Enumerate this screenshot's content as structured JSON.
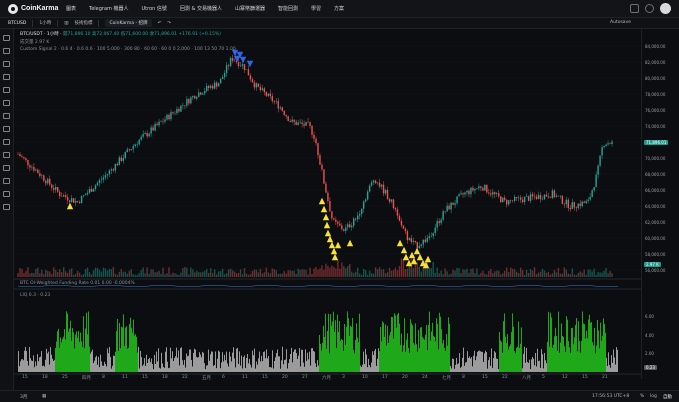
{
  "app": {
    "name": "CoinKarma"
  },
  "nav": {
    "items": [
      "圖表",
      "Telegram 機器人",
      "Utron 信號",
      "回測 & 交易機器人",
      "山寨幣篩選器",
      "智能回測",
      "學習",
      "方案"
    ]
  },
  "toolbar": {
    "symbol": "BTCUSD",
    "interval": "1小時",
    "indicators": "技術指標",
    "layout_tab": "CoinKarma - 招牌",
    "autosave": "Autosave"
  },
  "chart": {
    "title": "BTC/USDT · 1小時 · ",
    "ohlc": "開71,896.10 高72,067.40 低71,600.00 收71,896.01 +176.91 (+0.15%)",
    "volume": "成交量  2.97 K",
    "custom_signal": "Custom Signal  2 · 0.6 4 · 0.6 0.6 · 100 5.000 · 300 80 · 60 60 · 60 0 0 2,000 · 100 13 50 70   1.00",
    "funding_label": "BTC OI-Weighted Funding Rate  0.01  0.00  -0.0004%",
    "liq_label": "LIQ  0.3  ·  0.23",
    "price_scale": [
      "84,000.00",
      "82,000.00",
      "80,000.00",
      "78,000.00",
      "76,000.00",
      "74,000.00",
      "72,000.00",
      "70,000.00",
      "68,000.00",
      "66,000.00",
      "64,000.00",
      "62,000.00",
      "60,000.00",
      "58,000.00",
      "56,000.00"
    ],
    "last_price": "71,896.01",
    "volume_tag": "2.97 K",
    "liq_scale": [
      "6.00",
      "4.00",
      "2.00"
    ],
    "liq_tag": "0.23",
    "time_ticks": [
      "15",
      "18",
      "25",
      "四月",
      "8",
      "11",
      "15",
      "18",
      "22",
      "五月",
      "6",
      "11",
      "15",
      "20",
      "27",
      "六月",
      "3",
      "10",
      "17",
      "20",
      "24",
      "七月",
      "8",
      "15",
      "22",
      "八月",
      "5",
      "12",
      "15",
      "21"
    ]
  },
  "colors": {
    "up": "#26a69a",
    "down": "#ef5350",
    "signal_buy": "#f7e03b",
    "signal_sell": "#2f66e8",
    "liq_green": "#1fa81a",
    "liq_gray": "#9b9b9b"
  },
  "bottom": {
    "ranges": [
      "3月"
    ],
    "clock": "17:56:53 UTC+8",
    "pct": "%",
    "log": "log",
    "auto": "自動"
  }
}
